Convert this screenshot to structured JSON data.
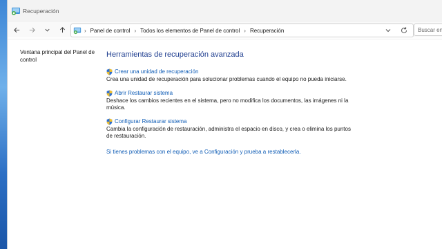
{
  "window": {
    "title": "Recuperación"
  },
  "navigation": {
    "breadcrumbs": [
      "Panel de control",
      "Todos los elementos de Panel de control",
      "Recuperación"
    ],
    "search_placeholder": "Buscar en e"
  },
  "sidebar": {
    "link": "Ventana principal del Panel de control"
  },
  "main": {
    "heading": "Herramientas de recuperación avanzada",
    "tasks": [
      {
        "label": "Crear una unidad de recuperación",
        "description": "Crea una unidad de recuperación para solucionar problemas cuando el equipo no pueda iniciarse."
      },
      {
        "label": "Abrir Restaurar sistema",
        "description": "Deshace los cambios recientes en el sistema, pero no modifica los documentos, las imágenes ni la música."
      },
      {
        "label": "Configurar Restaurar sistema",
        "description": "Cambia la configuración de restauración, administra el espacio en disco, y crea o elimina los puntos de restauración."
      }
    ],
    "reset_link": "Si tienes problemas con el equipo, ve a Configuración y prueba a restablecerla."
  },
  "icons": {
    "app": "control-panel-icon",
    "back": "arrow-left-icon",
    "forward": "arrow-right-icon",
    "recent": "chevron-down-icon",
    "up": "arrow-up-icon",
    "refresh": "refresh-icon",
    "task": "uac-shield-icon"
  },
  "colors": {
    "link": "#0d5bb5",
    "heading": "#1e3d8f",
    "text": "#1a1a1a"
  }
}
